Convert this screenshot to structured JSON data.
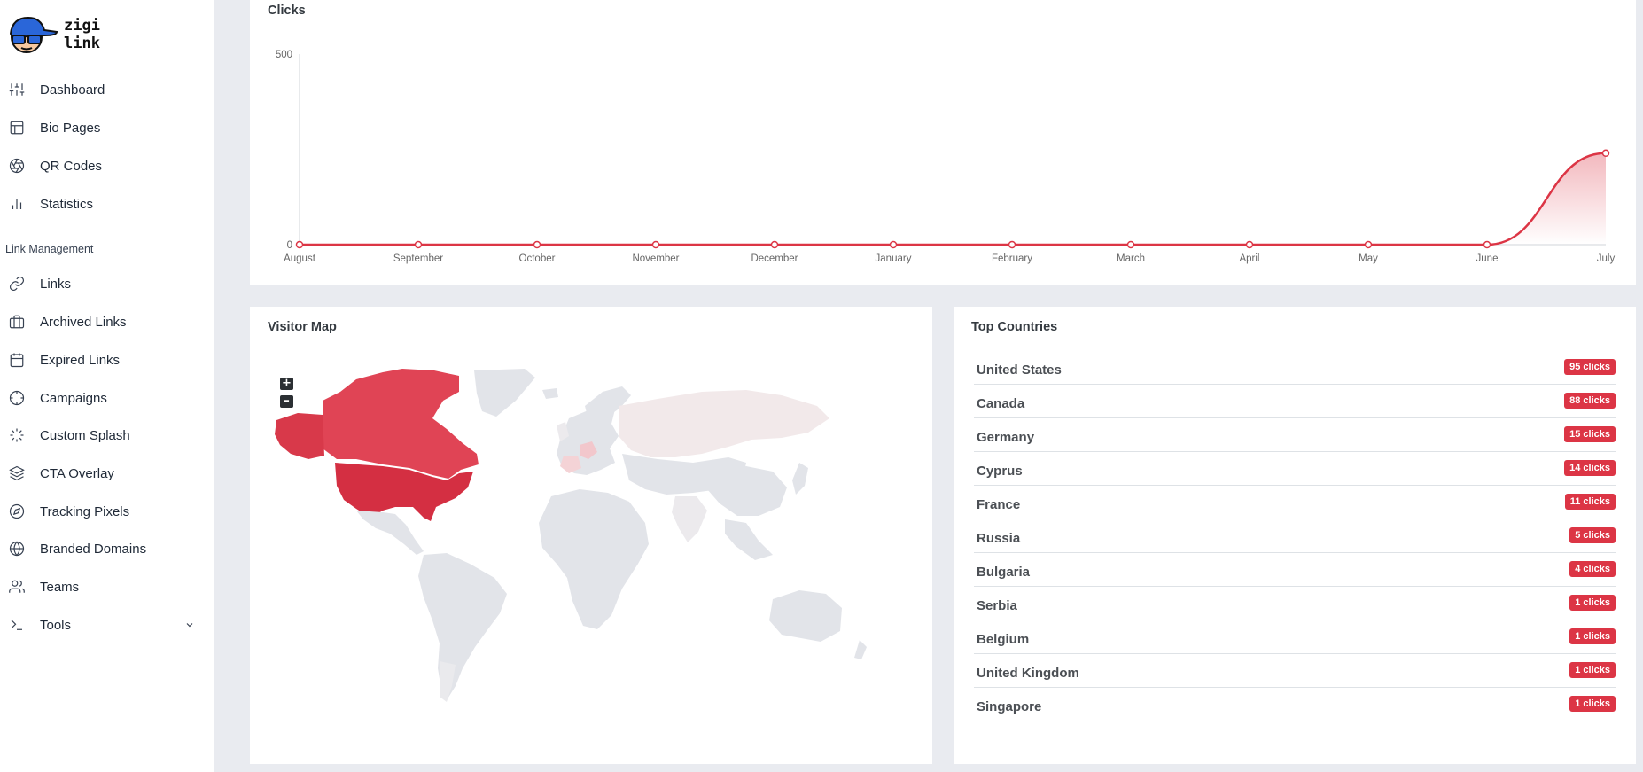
{
  "brand": {
    "line1": "zigi",
    "line2": "link"
  },
  "sidebar": {
    "items": [
      {
        "label": "Dashboard",
        "icon": "sliders-icon"
      },
      {
        "label": "Bio Pages",
        "icon": "layout-icon"
      },
      {
        "label": "QR Codes",
        "icon": "aperture-icon"
      },
      {
        "label": "Statistics",
        "icon": "bar-chart-icon"
      }
    ],
    "section_title": "Link Management",
    "link_items": [
      {
        "label": "Links",
        "icon": "link-icon"
      },
      {
        "label": "Archived Links",
        "icon": "briefcase-icon"
      },
      {
        "label": "Expired Links",
        "icon": "calendar-icon"
      },
      {
        "label": "Campaigns",
        "icon": "crosshair-icon"
      },
      {
        "label": "Custom Splash",
        "icon": "loader-icon"
      },
      {
        "label": "CTA Overlay",
        "icon": "layers-icon"
      },
      {
        "label": "Tracking Pixels",
        "icon": "compass-icon"
      },
      {
        "label": "Branded Domains",
        "icon": "globe-icon"
      },
      {
        "label": "Teams",
        "icon": "users-icon"
      },
      {
        "label": "Tools",
        "icon": "terminal-icon"
      }
    ]
  },
  "clicks": {
    "title": "Clicks",
    "chart_data": {
      "type": "area",
      "categories": [
        "August",
        "September",
        "October",
        "November",
        "December",
        "January",
        "February",
        "March",
        "April",
        "May",
        "June",
        "July"
      ],
      "values": [
        0,
        0,
        0,
        0,
        0,
        0,
        0,
        0,
        0,
        0,
        0,
        240
      ],
      "ylim": [
        0,
        500
      ],
      "yticks": [
        "0",
        "500"
      ],
      "color": "#dc3545"
    }
  },
  "visitor_map": {
    "title": "Visitor Map",
    "zoom_in": "+",
    "zoom_out": "–",
    "highlight_color": "#dc3545",
    "base_color": "#e2e4e9"
  },
  "top_countries": {
    "title": "Top Countries",
    "rows": [
      {
        "name": "United States",
        "clicks": "95 clicks"
      },
      {
        "name": "Canada",
        "clicks": "88 clicks"
      },
      {
        "name": "Germany",
        "clicks": "15 clicks"
      },
      {
        "name": "Cyprus",
        "clicks": "14 clicks"
      },
      {
        "name": "France",
        "clicks": "11 clicks"
      },
      {
        "name": "Russia",
        "clicks": "5 clicks"
      },
      {
        "name": "Bulgaria",
        "clicks": "4 clicks"
      },
      {
        "name": "Serbia",
        "clicks": "1 clicks"
      },
      {
        "name": "Belgium",
        "clicks": "1 clicks"
      },
      {
        "name": "United Kingdom",
        "clicks": "1 clicks"
      },
      {
        "name": "Singapore",
        "clicks": "1 clicks"
      }
    ]
  }
}
